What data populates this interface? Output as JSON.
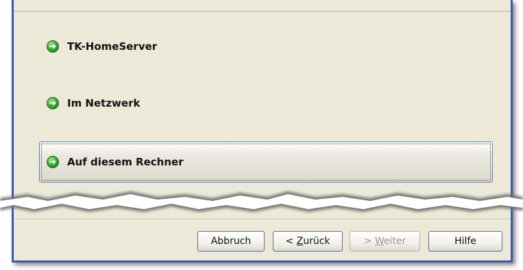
{
  "options": [
    {
      "label": "TK-HomeServer",
      "icon": "arrow-right-icon"
    },
    {
      "label": "Im Netzwerk",
      "icon": "arrow-right-icon"
    },
    {
      "label": "Auf diesem Rechner",
      "icon": "arrow-right-icon",
      "selected": true
    }
  ],
  "buttons": {
    "cancel": "Abbruch",
    "back_prefix": "< ",
    "back_underlined": "Z",
    "back_rest": "urück",
    "next_prefix": "> ",
    "next_underlined": "W",
    "next_rest": "eiter",
    "help": "Hilfe"
  },
  "colors": {
    "window_bg": "#ECE9D8",
    "frame": "#3a5aa8",
    "accent_green": "#33a02c"
  }
}
